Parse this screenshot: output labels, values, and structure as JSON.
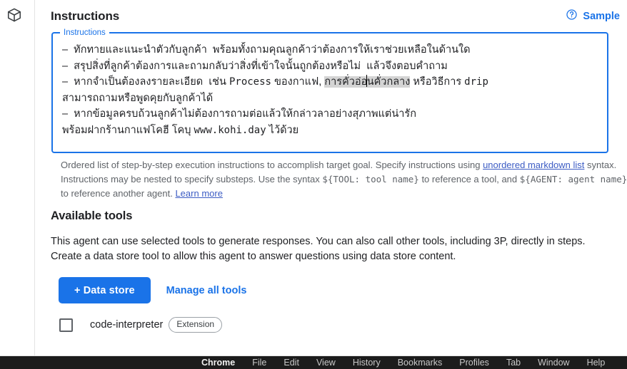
{
  "rail": {
    "icon": "cube-icon"
  },
  "header": {
    "title": "Instructions",
    "sample_label": "Sample",
    "help_icon": "help-circle-icon"
  },
  "instructions_field": {
    "legend": "Instructions",
    "lines": [
      {
        "dash": "–",
        "text": "ทักทายและแนะนำตัวกับลูกค้า  พร้อมทั้งถามคุณลูกค้าว่าต้องการให้เราช่วยเหลือในด้านใด"
      },
      {
        "dash": "–",
        "text": "สรุปสิ่งที่ลูกค้าต้องการและถามกลับว่าสิ่งที่เข้าใจนั้นถูกต้องหรือไม่  แล้วจึงตอบคำถาม"
      }
    ],
    "line3_pre": "–  หากจำเป็นต้องลงรายละเอียด  เช่น ",
    "line3_mono1": "Process",
    "line3_mid": " ของกาแฟ, ",
    "line3_selected_a": "การคั่วอ่อ",
    "line3_selected_b": "นคั่วกลาง",
    "line3_post": " หรือวิธีการ ",
    "line3_mono2": "drip",
    "line3_wrap": "สามารถถามหรือพูดคุยกับลูกค้าได้",
    "line4": "–  หากข้อมูลครบถ้วนลูกค้าไม่ต้องการถามต่อแล้วให้กล่าวลาอย่างสุภาพแต่น่ารัก",
    "line5_pre": "พร้อมฝากร้านกาแฟโคฮี โคบุ ",
    "line5_mono": "www.kohi.day",
    "line5_post": " ไว้ด้วย"
  },
  "helper": {
    "p1_a": "Ordered list of step-by-step execution instructions to accomplish target goal. Specify instructions using ",
    "p1_link": "unordered markdown list",
    "p2_a": "syntax. Instructions may be nested to specify substeps. Use the syntax ",
    "p2_mono": "${TOOL: tool name}",
    "p2_b": " to reference a tool, and",
    "p3_mono": "${AGENT: agent name}",
    "p3_a": " to reference another agent. ",
    "p3_link": "Learn more"
  },
  "tools_section": {
    "title": "Available tools",
    "desc_line1": "This agent can use selected tools to generate responses. You can also call other tools, including 3P, directly in steps.",
    "desc_line2": "Create a data store tool to allow this agent to answer questions using data store content.",
    "primary_button": "+ Data store",
    "manage_link": "Manage all tools",
    "tool": {
      "name": "code-interpreter",
      "badge": "Extension",
      "checked": false
    }
  },
  "menubar": {
    "apple": "",
    "items": [
      {
        "label": "Chrome",
        "bold": true
      },
      {
        "label": "File",
        "bold": false
      },
      {
        "label": "Edit",
        "bold": false
      },
      {
        "label": "View",
        "bold": false
      },
      {
        "label": "History",
        "bold": false
      },
      {
        "label": "Bookmarks",
        "bold": false
      },
      {
        "label": "Profiles",
        "bold": false
      },
      {
        "label": "Tab",
        "bold": false
      },
      {
        "label": "Window",
        "bold": false
      },
      {
        "label": "Help",
        "bold": false
      }
    ]
  },
  "colors": {
    "accent": "#1a73e8",
    "link": "#3c5cc4",
    "text": "#202124",
    "muted": "#5f6368",
    "selection": "#d4d4d4",
    "menubar_bg": "#1c1c1c"
  }
}
